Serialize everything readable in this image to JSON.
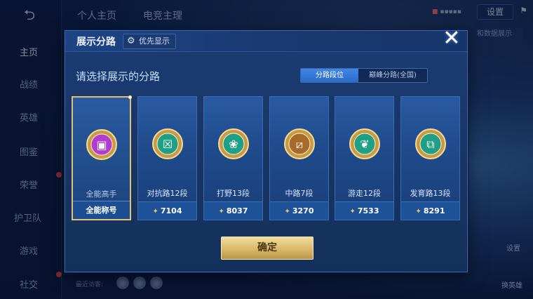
{
  "background": {
    "back_icon": "back-arrow-icon",
    "top_tabs": [
      "个人主页",
      "电竞主理"
    ],
    "nav_items": [
      {
        "label": "主页",
        "active": true
      },
      {
        "label": "战绩"
      },
      {
        "label": "英雄"
      },
      {
        "label": "图鉴"
      },
      {
        "label": "荣誉"
      },
      {
        "label": "护卫队"
      },
      {
        "label": "游戏"
      },
      {
        "label": "社交"
      }
    ],
    "settings_label": "设置",
    "data_display_label": "和数据展示",
    "recent_visitors_label": "最近访客:",
    "right_labels": [
      "设置",
      "换英雄"
    ]
  },
  "modal": {
    "title": "展示分路",
    "priority_label": "优先显示",
    "prompt": "请选择展示的分路",
    "segments": [
      {
        "label": "分路段位",
        "active": true
      },
      {
        "label": "巅峰分路(全国)",
        "active": false
      }
    ],
    "close_icon": "close-x-icon",
    "confirm_label": "确定",
    "cards": [
      {
        "label": "全能高手",
        "value": "全能称号",
        "selected": true,
        "color": "#b23bd0",
        "icon": "all-round-emblem-icon"
      },
      {
        "label": "对抗路12段",
        "value": "7104",
        "selected": false,
        "color": "#1f9f86",
        "icon": "clash-lane-emblem-icon"
      },
      {
        "label": "打野13段",
        "value": "8037",
        "selected": false,
        "color": "#1f9f86",
        "icon": "jungle-emblem-icon"
      },
      {
        "label": "中路7段",
        "value": "3270",
        "selected": false,
        "color": "#a86a2a",
        "icon": "mid-lane-emblem-icon"
      },
      {
        "label": "游走12段",
        "value": "7533",
        "selected": false,
        "color": "#1f9f86",
        "icon": "roam-emblem-icon"
      },
      {
        "label": "发育路13段",
        "value": "8291",
        "selected": false,
        "color": "#1f9f86",
        "icon": "farm-lane-emblem-icon"
      }
    ],
    "score_icon": "score-points-icon",
    "colors": {
      "accent_blue": "#2c6cc8",
      "gold": "#d9b96a",
      "selected_border": "#e2c074"
    }
  }
}
